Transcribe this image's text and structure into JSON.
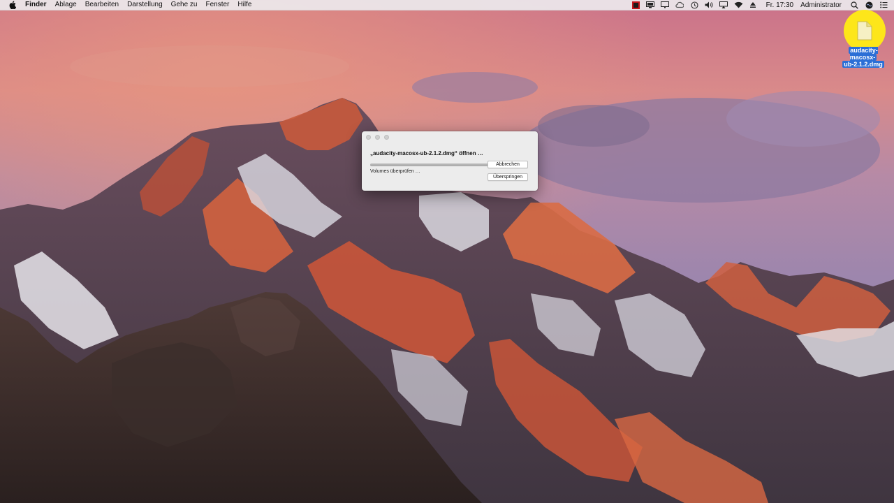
{
  "menubar": {
    "apple_icon": "apple-logo-icon",
    "app_name": "Finder",
    "menus": [
      "Ablage",
      "Bearbeiten",
      "Darstellung",
      "Gehe zu",
      "Fenster",
      "Hilfe"
    ],
    "status_icons": [
      "recording-icon",
      "display-icon",
      "monitor-icon",
      "creative-cloud-icon",
      "time-machine-icon",
      "volume-icon",
      "airplay-icon",
      "wifi-icon",
      "eject-icon"
    ],
    "clock": "Fr. 17:30",
    "user": "Administrator",
    "right_icons": [
      "spotlight-icon",
      "siri-icon",
      "notification-center-icon"
    ]
  },
  "desktop": {
    "file_label_line1": "audacity-macosx-",
    "file_label_line2": "ub-2.1.2.dmg",
    "highlight_color": "#ffec14",
    "selection_color": "#2b6fd6"
  },
  "dialog": {
    "title": "„audacity-macosx-ub-2.1.2.dmg“ öffnen …",
    "status": "Volumes überprüfen …",
    "progress": 1.0,
    "cancel_label": "Abbrechen",
    "skip_label": "Überspringen"
  }
}
